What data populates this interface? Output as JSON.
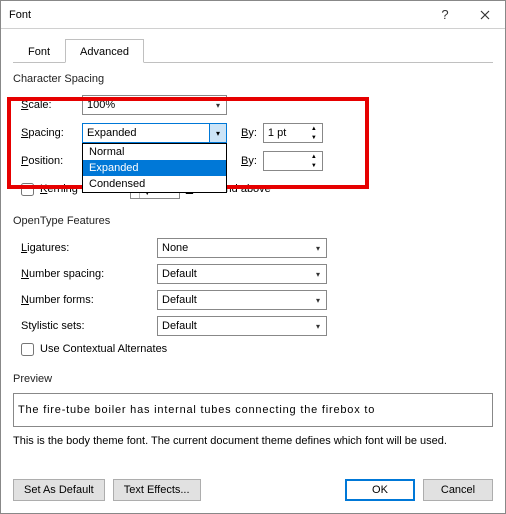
{
  "window": {
    "title": "Font"
  },
  "tabs": {
    "font": "Font",
    "advanced": "Advanced"
  },
  "charSpacing": {
    "heading": "Character Spacing",
    "scaleLabel": "Scale:",
    "scaleValue": "100%",
    "spacingLabel": "Spacing:",
    "spacingValue": "Expanded",
    "spacingOptions": {
      "normal": "Normal",
      "expanded": "Expanded",
      "condensed": "Condensed"
    },
    "byLabel": "By:",
    "by1Value": "1 pt",
    "positionLabel": "Position:",
    "by2Label": "By:",
    "by2Value": "",
    "kerningLabel": "Kerning for fonts:",
    "kerningSuffix": "Points and above"
  },
  "opentype": {
    "heading": "OpenType Features",
    "ligaturesLabel": "Ligatures:",
    "ligaturesValue": "None",
    "numSpacingLabel": "Number spacing:",
    "numSpacingValue": "Default",
    "numFormsLabel": "Number forms:",
    "numFormsValue": "Default",
    "styleSetsLabel": "Stylistic sets:",
    "styleSetsValue": "Default",
    "contextualLabel": "Use Contextual Alternates"
  },
  "preview": {
    "heading": "Preview",
    "text": "The fire-tube boiler has internal tubes connecting the firebox to",
    "desc": "This is the body theme font. The current document theme defines which font will be used."
  },
  "buttons": {
    "setDefault": "Set As Default",
    "textEffects": "Text Effects...",
    "ok": "OK",
    "cancel": "Cancel"
  }
}
